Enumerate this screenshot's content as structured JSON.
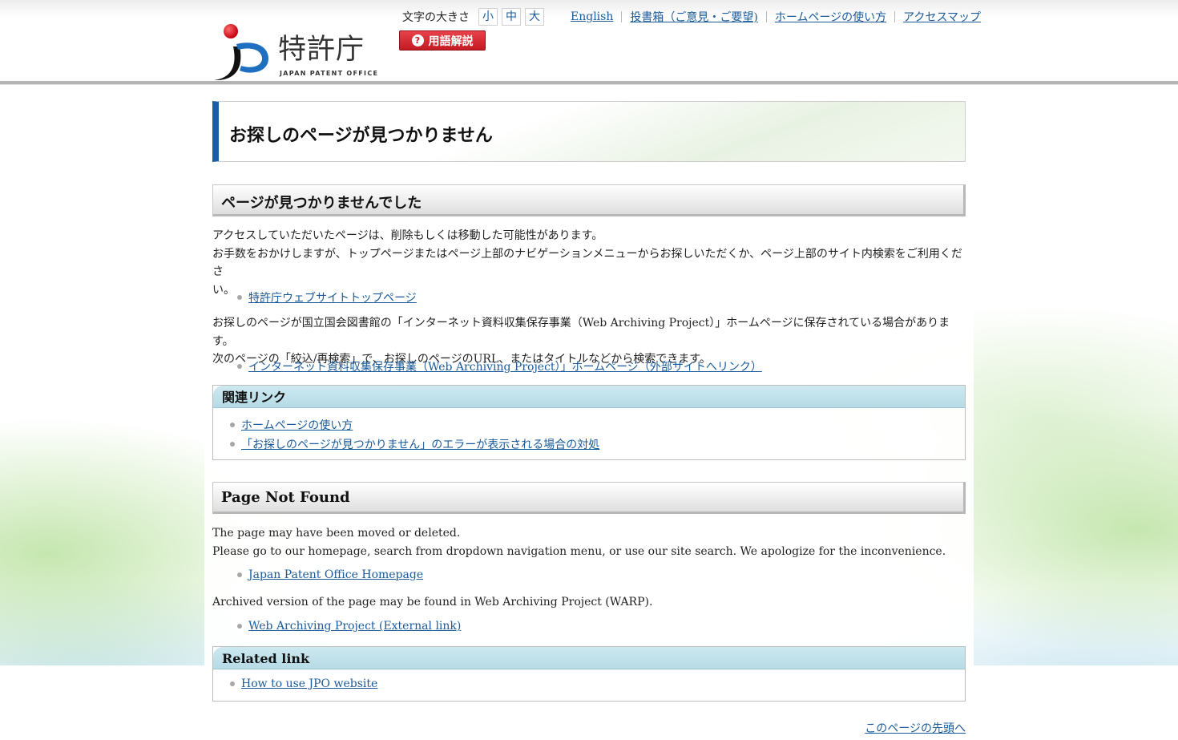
{
  "header": {
    "logo": {
      "name_jp": "特許庁",
      "name_en": "JAPAN PATENT OFFICE"
    },
    "font_size": {
      "label": "文字の大きさ",
      "options": [
        "小",
        "中",
        "大"
      ]
    },
    "glossary_button": "用語解説",
    "links": [
      "English",
      "投書箱（ご意見・ご要望)",
      "ホームページの使い方",
      "アクセスマップ"
    ]
  },
  "page_title": "お探しのページが見つかりません",
  "jp_section": {
    "heading": "ページが見つかりませんでした",
    "para1_line1": "アクセスしていただいたページは、削除もしくは移動した可能性があります。",
    "para1_line2": "お手数をおかけしますが、トップページまたはページ上部のナビゲーションメニューからお探しいただくか、ページ上部のサイト内検索をご利用くださ",
    "para1_line3": "い。",
    "link1": "特許庁ウェブサイトトップページ",
    "para2_line1": "お探しのページが国立国会図書館の「インターネット資料収集保存事業（Web Archiving Project）」ホームページに保存されている場合があります。",
    "para2_line2": "次のページの「絞込/再検索」で、お探しのページのURL、またはタイトルなどから検索できます。",
    "link2": "インターネット資料収集保存事業（Web Archiving Project）」ホームページ（外部サイトへリンク）",
    "related": {
      "heading": "関連リンク",
      "items": [
        "ホームページの使い方",
        "「お探しのページが見つかりません」のエラーが表示される場合の対処"
      ]
    }
  },
  "en_section": {
    "heading": "Page Not Found",
    "para1_line1": "The page may have been moved or deleted.",
    "para1_line2": "Please go to our homepage, search from dropdown navigation menu, or use our site search. We apologize for the inconvenience.",
    "link1": "Japan Patent Office Homepage",
    "para2": "Archived version of the page may be found in Web Archiving Project (WARP).",
    "link2": "Web Archiving Project (External link)",
    "related": {
      "heading": "Related link",
      "items": [
        "How to use JPO website"
      ]
    }
  },
  "page_top": "このページの先頭へ",
  "colors": {
    "link": "#1a5a9a",
    "title_accent": "#1d5fa5",
    "glossary_red": "#c41a22",
    "related_header": "#b6dbe6"
  }
}
